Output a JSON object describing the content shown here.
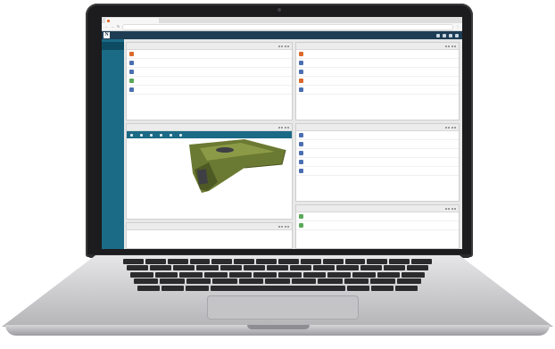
{
  "browser": {
    "tab_title": "",
    "url": ""
  },
  "app": {
    "title": "",
    "accent_color": "#1b6a86",
    "header_color": "#1e3d55"
  },
  "sidebar": {
    "items": [
      {
        "label": "",
        "active": true
      },
      {
        "label": ""
      },
      {
        "label": ""
      },
      {
        "label": ""
      }
    ]
  },
  "panels": {
    "top_left": {
      "title": "",
      "rows": [
        {
          "icon": "part-icon",
          "name": "",
          "sub": "",
          "meta": ""
        },
        {
          "icon": "document-icon",
          "name": "",
          "sub": "",
          "meta": ""
        },
        {
          "icon": "document-icon",
          "name": "",
          "sub": "",
          "meta": ""
        },
        {
          "icon": "green-doc-icon",
          "name": "",
          "sub": "",
          "meta": ""
        },
        {
          "icon": "document-icon",
          "name": "",
          "sub": "",
          "meta": ""
        }
      ],
      "pager": ""
    },
    "top_right": {
      "title": "",
      "rows": [
        {
          "icon": "part-icon",
          "name": "",
          "sub": "",
          "meta": ""
        },
        {
          "icon": "document-icon",
          "name": "",
          "sub": "",
          "meta": ""
        },
        {
          "icon": "document-icon",
          "name": "",
          "sub": "",
          "meta": ""
        },
        {
          "icon": "part-icon",
          "name": "",
          "sub": "",
          "meta": ""
        },
        {
          "icon": "document-icon",
          "name": "",
          "sub": "",
          "meta": ""
        }
      ],
      "pager": ""
    },
    "viewer": {
      "title": "",
      "tree": [
        "",
        "",
        ""
      ]
    },
    "mid_right": {
      "title": "",
      "rows": [
        {
          "icon": "document-icon",
          "name": "",
          "sub": "",
          "meta": ""
        },
        {
          "icon": "document-icon",
          "name": "",
          "sub": "",
          "meta": ""
        },
        {
          "icon": "document-icon",
          "name": "",
          "sub": "",
          "meta": ""
        },
        {
          "icon": "document-icon",
          "name": "",
          "sub": "",
          "meta": ""
        },
        {
          "icon": "document-icon",
          "name": "",
          "sub": "",
          "meta": ""
        }
      ]
    },
    "bottom_right": {
      "title": "",
      "rows": [
        {
          "icon": "green-doc-icon",
          "name": "",
          "sub": "",
          "meta": ""
        },
        {
          "icon": "green-doc-icon",
          "name": "",
          "sub": "",
          "meta": ""
        }
      ]
    },
    "bottom_left": {
      "title": ""
    }
  }
}
